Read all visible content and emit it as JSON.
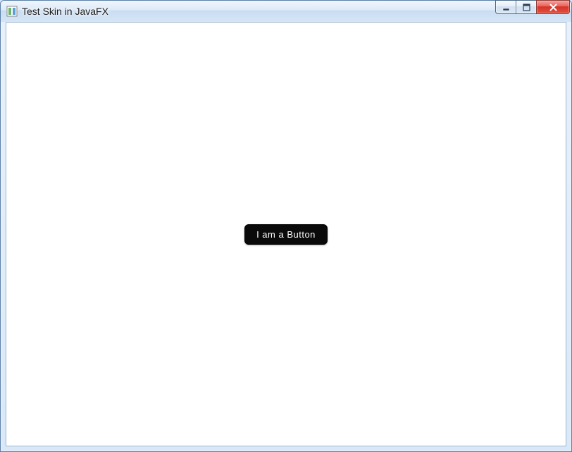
{
  "window": {
    "title": "Test Skin in JavaFX"
  },
  "controls": {
    "minimize_tooltip": "Minimize",
    "maximize_tooltip": "Maximize",
    "close_tooltip": "Close"
  },
  "content": {
    "button_label": "I am a Button"
  },
  "colors": {
    "button_bg": "#0a0a0a",
    "button_fg": "#ffffff",
    "client_bg": "#ffffff"
  }
}
